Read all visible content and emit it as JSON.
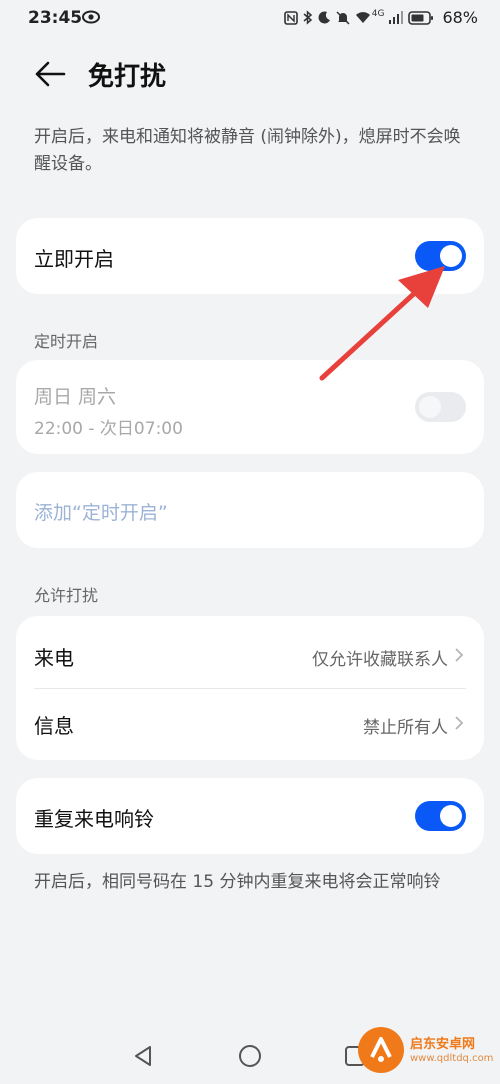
{
  "status_bar": {
    "time": "23:45",
    "network": "4G",
    "battery": "68%"
  },
  "header": {
    "title": "免打扰"
  },
  "description": "开启后，来电和通知将被静音 (闹钟除外)，熄屏时不会唤醒设备。",
  "immediate": {
    "label": "立即开启",
    "enabled": true
  },
  "scheduled": {
    "section_label": "定时开启",
    "days": "周日 周六",
    "time_range": "22:00 - 次日07:00",
    "enabled": false,
    "add_label": "添加“定时开启”"
  },
  "allow": {
    "section_label": "允许打扰",
    "rows": [
      {
        "label": "来电",
        "value": "仅允许收藏联系人"
      },
      {
        "label": "信息",
        "value": "禁止所有人"
      }
    ]
  },
  "repeat_call": {
    "label": "重复来电响铃",
    "enabled": true
  },
  "note": "开启后，相同号码在 15 分钟内重复来电将会正常响铃",
  "watermark": {
    "name": "启东安卓网",
    "url": "www.qdltdq.com"
  },
  "colors": {
    "accent": "#0a59f7",
    "arrow": "#e8403a",
    "background": "#f1f3f5"
  }
}
